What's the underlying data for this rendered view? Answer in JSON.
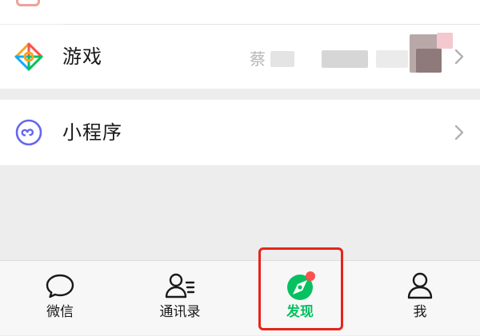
{
  "list": {
    "top_item": {
      "icon": "partial-app-icon"
    },
    "games": {
      "label": "游戏",
      "icon": "games-diamond-icon",
      "preview_text": "蔡"
    },
    "mini_programs": {
      "label": "小程序",
      "icon": "mini-program-icon"
    }
  },
  "tab_bar": {
    "tabs": [
      {
        "label": "微信",
        "icon": "chat-bubble-icon"
      },
      {
        "label": "通讯录",
        "icon": "contacts-icon"
      },
      {
        "label": "发现",
        "icon": "compass-icon",
        "active": true,
        "badge": "red-dot"
      },
      {
        "label": "我",
        "icon": "person-icon"
      }
    ]
  },
  "colors": {
    "active_tab": "#07c160",
    "badge": "#fa5151",
    "highlight": "#e8231a",
    "background": "#ededed"
  }
}
